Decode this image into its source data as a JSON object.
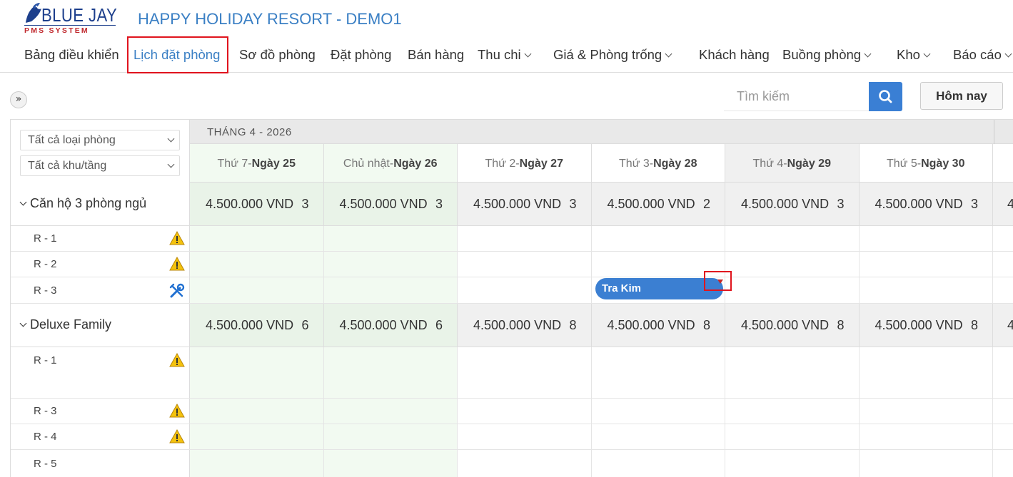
{
  "logo": {
    "name": "BLUE JAY",
    "sub": "PMS SYSTEM"
  },
  "resort_title": "HAPPY HOLIDAY RESORT - DEMO1",
  "nav": {
    "items": [
      {
        "label": "Bảng điều khiển"
      },
      {
        "label": "Lịch đặt phòng",
        "active": true
      },
      {
        "label": "Sơ đồ phòng"
      },
      {
        "label": "Đặt phòng"
      },
      {
        "label": "Bán hàng"
      },
      {
        "label": "Thu chi",
        "dropdown": true
      },
      {
        "label": "Giá & Phòng trống",
        "dropdown": true
      },
      {
        "label": "Khách hàng"
      },
      {
        "label": "Buồng phòng",
        "dropdown": true
      },
      {
        "label": "Kho",
        "dropdown": true
      },
      {
        "label": "Báo cáo",
        "dropdown": true
      }
    ]
  },
  "toolbar": {
    "toggle_label": "»",
    "search_placeholder": "Tìm kiếm",
    "today_label": "Hôm nay"
  },
  "filters": {
    "room_type": "Tất cả loại phòng",
    "area": "Tất cả khu/tầng"
  },
  "month_label": "THÁNG 4 - 2026",
  "days": [
    {
      "weekday": "Thứ 7",
      "date": "Ngày 25",
      "weekend": true
    },
    {
      "weekday": "Chủ nhật",
      "date": "Ngày 26",
      "weekend": true
    },
    {
      "weekday": "Thứ 2",
      "date": "Ngày 27",
      "weekend": false
    },
    {
      "weekday": "Thứ 3",
      "date": "Ngày 28",
      "weekend": false
    },
    {
      "weekday": "Thứ 4",
      "date": "Ngày 29",
      "weekend": false
    },
    {
      "weekday": "Thứ 5",
      "date": "Ngày 30",
      "weekend": false
    }
  ],
  "groups": [
    {
      "name": "Căn hộ 3 phòng ngủ",
      "prices": [
        {
          "amount": "4.500.000 VND",
          "count": "3"
        },
        {
          "amount": "4.500.000 VND",
          "count": "3"
        },
        {
          "amount": "4.500.000 VND",
          "count": "3"
        },
        {
          "amount": "4.500.000 VND",
          "count": "2"
        },
        {
          "amount": "4.500.000 VND",
          "count": "3"
        },
        {
          "amount": "4.500.000 VND",
          "count": "3"
        }
      ],
      "rooms": [
        {
          "label": "R - 1",
          "icon": "warning-icon"
        },
        {
          "label": "R - 2",
          "icon": "warning-icon"
        },
        {
          "label": "R - 3",
          "icon": "tools-icon"
        }
      ]
    },
    {
      "name": "Deluxe Family",
      "prices": [
        {
          "amount": "4.500.000 VND",
          "count": "6"
        },
        {
          "amount": "4.500.000 VND",
          "count": "6"
        },
        {
          "amount": "4.500.000 VND",
          "count": "8"
        },
        {
          "amount": "4.500.000 VND",
          "count": "8"
        },
        {
          "amount": "4.500.000 VND",
          "count": "8"
        },
        {
          "amount": "4.500.000 VND",
          "count": "8"
        }
      ],
      "rooms": [
        {
          "label": "R - 1",
          "icon": "warning-icon"
        },
        {
          "label": "R - 3",
          "icon": "warning-icon"
        },
        {
          "label": "R - 4",
          "icon": "warning-icon"
        },
        {
          "label": "R - 5",
          "icon": ""
        }
      ]
    }
  ],
  "booking": {
    "guest": "Tra Kim",
    "color": "#3b7fd2"
  },
  "colors": {
    "accent": "#3a7fc4",
    "highlight": "#e0141e",
    "weekend_bg": "#f2faf1"
  }
}
